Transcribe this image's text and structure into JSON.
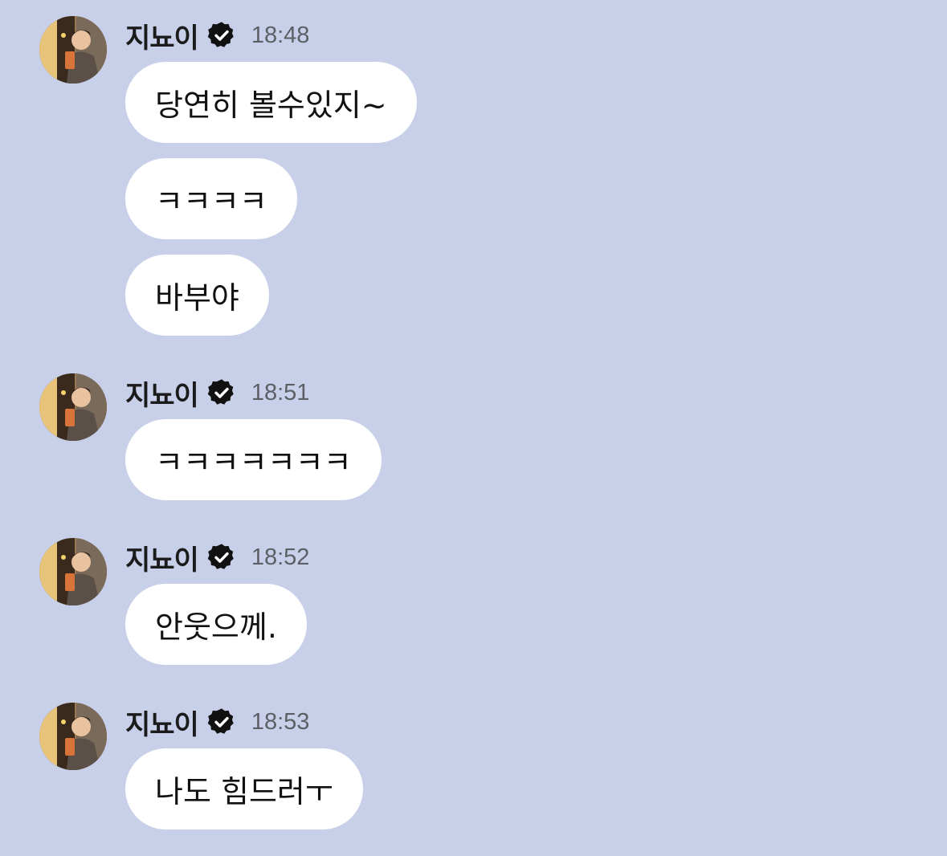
{
  "chat": {
    "background": "#c8d0e9",
    "bubble_color": "#ffffff",
    "groups": [
      {
        "sender": "지뇨이",
        "time": "18:48",
        "messages": [
          "당연히 볼수있지~",
          "ㅋㅋㅋㅋ",
          "바부야"
        ]
      },
      {
        "sender": "지뇨이",
        "time": "18:51",
        "messages": [
          "ㅋㅋㅋㅋㅋㅋㅋ"
        ]
      },
      {
        "sender": "지뇨이",
        "time": "18:52",
        "messages": [
          "안웃으께."
        ]
      },
      {
        "sender": "지뇨이",
        "time": "18:53",
        "messages": [
          "나도 힘드러ㅜ"
        ]
      }
    ]
  }
}
